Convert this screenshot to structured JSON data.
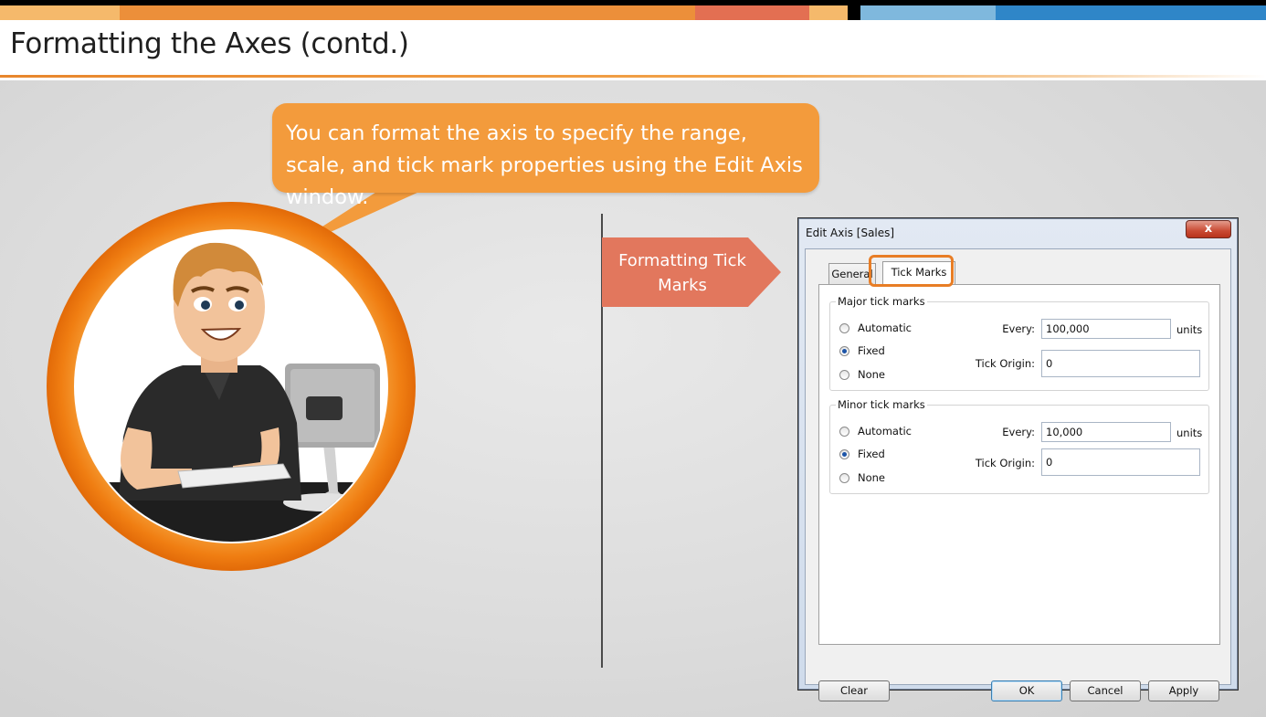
{
  "slide": {
    "title": "Formatting the Axes (contd.)"
  },
  "stripe_colors": [
    "#f5b96b",
    "#ec8f3a",
    "#e36f52",
    "#f5b96b",
    "#7fb8dd",
    "#2f86c8"
  ],
  "callout": {
    "text": "You can format the axis to specify the range, scale, and tick mark properties using the Edit Axis window.",
    "color": "#f39b3c"
  },
  "tag": {
    "text": "Formatting Tick Marks",
    "color": "#e2775d"
  },
  "dialog": {
    "title": "Edit Axis [Sales]",
    "close_glyph": "x",
    "tabs": [
      {
        "label": "General",
        "active": false
      },
      {
        "label": "Tick Marks",
        "active": true
      }
    ],
    "major": {
      "label": "Major tick marks",
      "options": [
        "Automatic",
        "Fixed",
        "None"
      ],
      "selected": "Fixed",
      "every_label": "Every:",
      "every_value": "100,000",
      "units_label": "units",
      "origin_label": "Tick Origin:",
      "origin_value": "0"
    },
    "minor": {
      "label": "Minor tick marks",
      "options": [
        "Automatic",
        "Fixed",
        "None"
      ],
      "selected": "Fixed",
      "every_label": "Every:",
      "every_value": "10,000",
      "units_label": "units",
      "origin_label": "Tick Origin:",
      "origin_value": "0"
    },
    "buttons": {
      "clear": "Clear",
      "ok": "OK",
      "cancel": "Cancel",
      "apply": "Apply"
    }
  },
  "icons": {
    "avatar": "presenter-at-computer-icon",
    "close": "close-icon",
    "radio": "radio-icon"
  }
}
